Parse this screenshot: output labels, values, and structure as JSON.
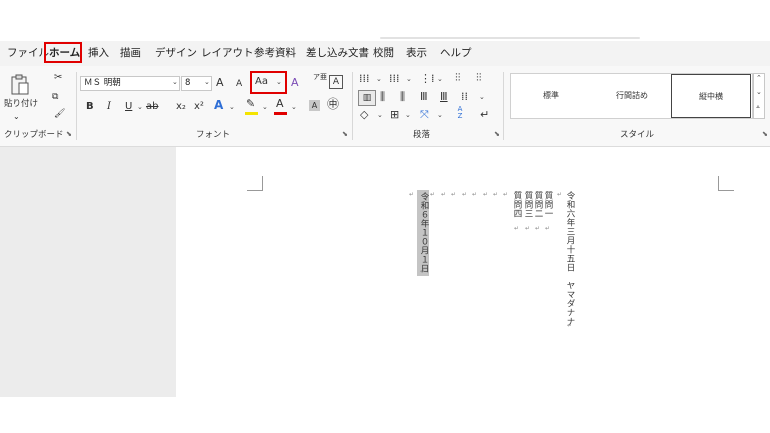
{
  "menu": {
    "tabs": [
      "ファイル",
      "ホーム",
      "挿入",
      "描画",
      "デザイン",
      "レイアウト",
      "参考資料",
      "差し込み文書",
      "校閲",
      "表示",
      "ヘルプ"
    ],
    "active": "ホーム"
  },
  "clipboard": {
    "paste_label": "貼り付け",
    "group_label": "クリップボード"
  },
  "font": {
    "name": "ＭＳ 明朝",
    "size": "8",
    "grow": "A",
    "shrink": "A",
    "case_button": "Aa",
    "clear_format": "A",
    "bold": "B",
    "italic": "I",
    "underline": "U",
    "strike": "ab",
    "subscript": "x₂",
    "superscript": "x²",
    "text_effect": "A",
    "font_color": "A",
    "char_shade": "A",
    "ruby": "ア亜",
    "char_border": "A",
    "group_label": "フォント"
  },
  "paragraph": {
    "group_label": "段落",
    "sort": "A Z"
  },
  "styles": {
    "items": [
      "標準",
      "行間詰め",
      "縦中横"
    ],
    "selected": "縦中横",
    "group_label": "スタイル"
  },
  "document": {
    "title_col": "令和６年１０月１日",
    "col_right": "令和六年三月十五日　ヤマダナナ",
    "questions": [
      "質問一",
      "質問二",
      "質問三",
      "質問四"
    ]
  },
  "colors": {
    "highlight": "#c4c4c4",
    "red": "#e00000",
    "yellow": "#f4e400"
  }
}
